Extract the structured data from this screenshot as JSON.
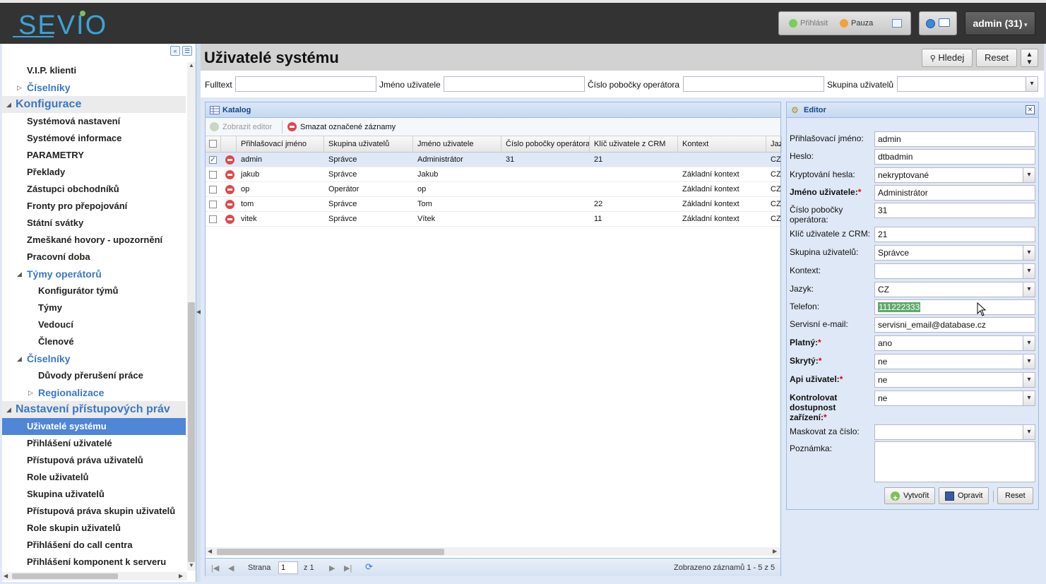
{
  "header": {
    "logo_text": "SEVIO",
    "login_label": "Přihlásit",
    "pause_label": "Pauza",
    "user_label": "admin (31)",
    "colors": {
      "bar": "#333333",
      "logo": "#3aa4d8",
      "login_dot": "#7ccc5a",
      "pause_dot": "#f2a23a"
    }
  },
  "sidebar": {
    "items": [
      {
        "label": "V.I.P. klienti",
        "level": "l1"
      },
      {
        "label": "Číselníky",
        "level": "l1 sec",
        "arrow": "▷"
      },
      {
        "label": "Konfigurace",
        "level": "top",
        "arrow": "◢"
      },
      {
        "label": "Systémová nastavení",
        "level": "l1"
      },
      {
        "label": "Systémové informace",
        "level": "l1"
      },
      {
        "label": "PARAMETRY",
        "level": "l1"
      },
      {
        "label": "Překlady",
        "level": "l1"
      },
      {
        "label": "Zástupci obchodníků",
        "level": "l1"
      },
      {
        "label": "Fronty pro přepojování",
        "level": "l1"
      },
      {
        "label": "Státní svátky",
        "level": "l1"
      },
      {
        "label": "Zmeškané hovory - upozornění",
        "level": "l1"
      },
      {
        "label": "Pracovní doba",
        "level": "l1"
      },
      {
        "label": "Týmy operátorů",
        "level": "l1 sec",
        "arrow": "◢"
      },
      {
        "label": "Konfigurátor týmů",
        "level": "l2"
      },
      {
        "label": "Týmy",
        "level": "l2"
      },
      {
        "label": "Vedoucí",
        "level": "l2"
      },
      {
        "label": "Členové",
        "level": "l2"
      },
      {
        "label": "Číselníky",
        "level": "l1 sec",
        "arrow": "◢"
      },
      {
        "label": "Důvody přerušení práce",
        "level": "l2"
      },
      {
        "label": "Regionalizace",
        "level": "l2 sec",
        "arrow": "▷"
      },
      {
        "label": "Nastavení přístupových práv",
        "level": "top",
        "arrow": "◢"
      },
      {
        "label": "Uživatelé systému",
        "level": "l1 active"
      },
      {
        "label": "Přihlášení uživatelé",
        "level": "l1"
      },
      {
        "label": "Přístupová práva uživatelů",
        "level": "l1"
      },
      {
        "label": "Role uživatelů",
        "level": "l1"
      },
      {
        "label": "Skupina uživatelů",
        "level": "l1"
      },
      {
        "label": "Přístupová práva skupin uživatelů",
        "level": "l1"
      },
      {
        "label": "Role skupin uživatelů",
        "level": "l1"
      },
      {
        "label": "Přihlášení do call centra",
        "level": "l1"
      },
      {
        "label": "Přihlášení komponent k serveru",
        "level": "l1"
      }
    ]
  },
  "main": {
    "title": "Uživatelé systému",
    "search_label": "Hledej",
    "reset_label": "Reset",
    "filters": {
      "fulltext": "Fulltext",
      "username": "Jméno uživatele",
      "branch": "Číslo pobočky operátora",
      "group": "Skupina uživatelů"
    }
  },
  "catalog": {
    "title": "Katalog",
    "show_editor": "Zobrazit editor",
    "delete_marked": "Smazat označené záznamy",
    "columns": [
      "Přihlašovací jméno",
      "Skupina uživatelů",
      "Jméno uživatele",
      "Číslo pobočky operátora",
      "Klíč uživatele z CRM",
      "Kontext",
      "Jaz"
    ],
    "rows": [
      {
        "checked": "✓",
        "login": "admin",
        "group": "Správce",
        "name": "Administrátor",
        "branch": "31",
        "crm": "21",
        "context": "",
        "lang": "CZ"
      },
      {
        "checked": "",
        "login": "jakub",
        "group": "Správce",
        "name": "Jakub",
        "branch": "",
        "crm": "",
        "context": "Základní kontext",
        "lang": "CZ"
      },
      {
        "checked": "",
        "login": "op",
        "group": "Operátor",
        "name": "op",
        "branch": "",
        "crm": "",
        "context": "Základní kontext",
        "lang": "CZ"
      },
      {
        "checked": "",
        "login": "tom",
        "group": "Správce",
        "name": "Tom",
        "branch": "",
        "crm": "22",
        "context": "Základní kontext",
        "lang": "CZ"
      },
      {
        "checked": "",
        "login": "vitek",
        "group": "Správce",
        "name": "Vítek",
        "branch": "",
        "crm": "11",
        "context": "Základní kontext",
        "lang": "CZ"
      }
    ],
    "pager": {
      "page_label": "Strana",
      "page": "1",
      "of_label": "z 1",
      "summary": "Zobrazeno záznamů 1 - 5 z 5"
    }
  },
  "editor": {
    "title": "Editor",
    "fields": [
      {
        "label": "Přihlašovací jméno:",
        "value": "admin",
        "required": false,
        "select": false
      },
      {
        "label": "Heslo:",
        "value": "dtbadmin",
        "required": false,
        "select": false
      },
      {
        "label": "Kryptování hesla:",
        "value": "nekryptované",
        "required": false,
        "select": true
      },
      {
        "label": "Jméno uživatele:",
        "value": "Administrátor",
        "required": true,
        "select": false
      },
      {
        "label": "Číslo pobočky operátora:",
        "value": "31",
        "required": false,
        "select": false
      },
      {
        "label": "Klíč uživatele z CRM:",
        "value": "21",
        "required": false,
        "select": false
      },
      {
        "label": "Skupina uživatelů:",
        "value": "Správce",
        "required": false,
        "select": true
      },
      {
        "label": "Kontext:",
        "value": "",
        "required": false,
        "select": true
      },
      {
        "label": "Jazyk:",
        "value": "CZ",
        "required": false,
        "select": true
      },
      {
        "label": "Telefon:",
        "value": "111222333",
        "required": false,
        "select": false,
        "highlight": true
      },
      {
        "label": "Servisní e-mail:",
        "value": "servisni_email@database.cz",
        "required": false,
        "select": false
      },
      {
        "label": "Platný:",
        "value": "ano",
        "required": true,
        "select": true
      },
      {
        "label": "Skrytý:",
        "value": "ne",
        "required": true,
        "select": true
      },
      {
        "label": "Api uživatel:",
        "value": "ne",
        "required": true,
        "select": true
      },
      {
        "label": "Kontrolovat dostupnost zařízení:",
        "value": "ne",
        "required": true,
        "select": true
      },
      {
        "label": "Maskovat za číslo:",
        "value": "",
        "required": false,
        "select": true
      },
      {
        "label": "Poznámka:",
        "value": "",
        "required": false,
        "select": false,
        "textarea": true
      }
    ],
    "create_label": "Vytvořit",
    "save_label": "Opravit",
    "reset_label": "Reset"
  }
}
